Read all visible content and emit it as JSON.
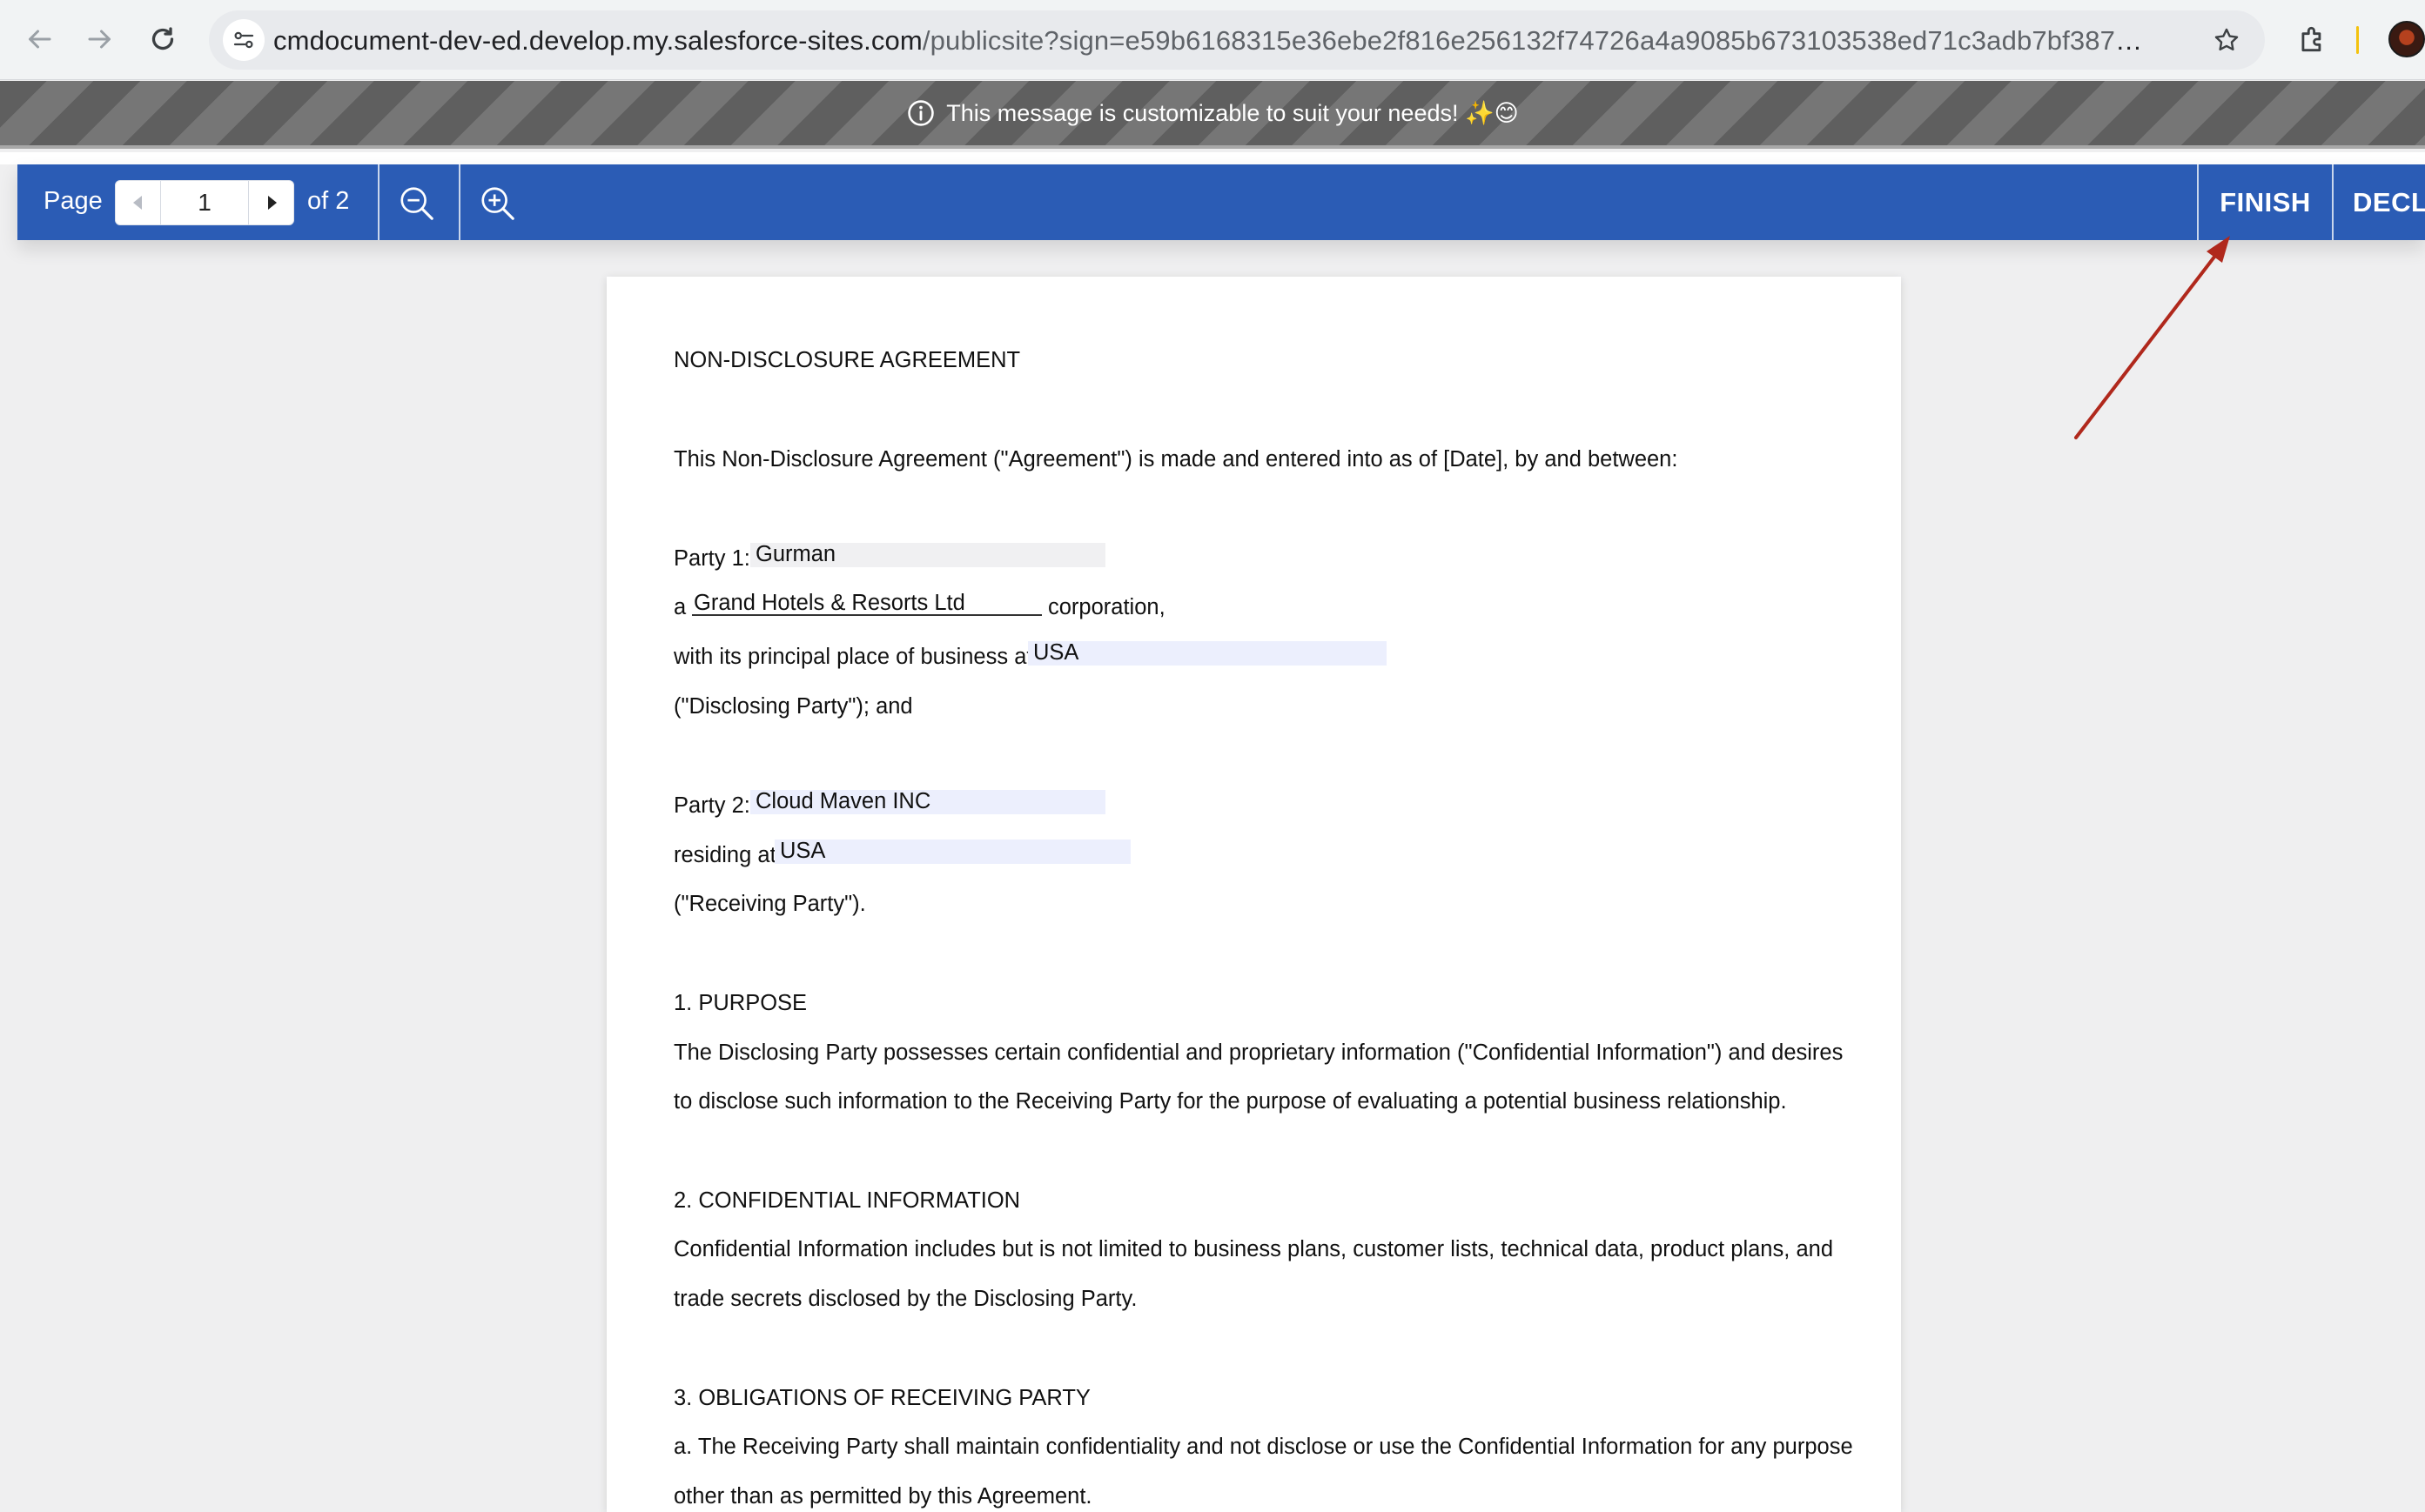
{
  "browser": {
    "url_host": "cmdocument-dev-ed.develop.my.salesforce-sites.com",
    "url_path": "/publicsite?sign=e59b6168315e36ebe2f816e256132f74726a4a9085b673103538ed71c3adb7bf387e29ed30..."
  },
  "banner": {
    "message": "This message is customizable to suit your needs! ✨😊"
  },
  "toolbar": {
    "page_label": "Page",
    "current_page": "1",
    "of_label": "of 2",
    "finish_label": "FINISH",
    "decline_label": "DECLINE"
  },
  "document": {
    "title": "NON-DISCLOSURE AGREEMENT",
    "intro": "This Non-Disclosure Agreement (\"Agreement\") is made and entered into as of [Date], by and between:",
    "party1_label": "Party 1:",
    "party1_name": "Gurman",
    "party1_a": "a",
    "party1_company": "Grand Hotels & Resorts Ltd",
    "party1_corporation": "corporation,",
    "party1_place_label": "with its principal place of business at",
    "party1_place": "USA",
    "party1_role": "(\"Disclosing Party\"); and",
    "party2_label": "Party 2:",
    "party2_name": "Cloud Maven INC",
    "party2_residing_label": "residing at",
    "party2_place": "USA",
    "party2_role": "(\"Receiving Party\").",
    "s1_heading": "1. PURPOSE",
    "s1_line1": "The Disclosing Party possesses certain confidential and proprietary information (\"Confidential Information\") and desires",
    "s1_line2": "to disclose such information to the Receiving Party for the purpose of evaluating a potential business relationship.",
    "s2_heading": "2. CONFIDENTIAL INFORMATION",
    "s2_line1": "Confidential Information includes but is not limited to business plans, customer lists, technical data, product plans, and",
    "s2_line2": "trade secrets disclosed by the Disclosing Party.",
    "s3_heading": "3. OBLIGATIONS OF RECEIVING PARTY",
    "s3_line1": "a. The Receiving Party shall maintain confidentiality and not disclose or use the Confidential Information for any purpose",
    "s3_line2": "other than as permitted by this Agreement."
  },
  "colors": {
    "toolbar_bg": "#2b5cb5",
    "annotation_arrow": "#b0281c",
    "field_grey": "#f0f0f2",
    "field_blue": "#eceffd"
  }
}
